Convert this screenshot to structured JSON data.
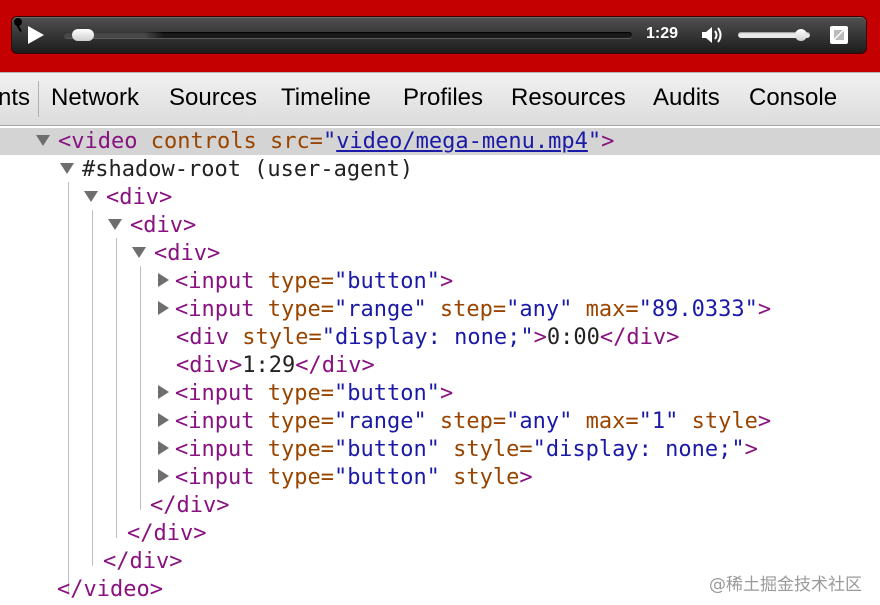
{
  "video_controls": {
    "time": "1:29",
    "playback_progress": 0.015,
    "volume_level": 0.95,
    "icons": [
      "pin-icon",
      "play-icon",
      "volume-icon",
      "fullscreen-icon"
    ]
  },
  "devtools": {
    "tabs": [
      "nts",
      "Network",
      "Sources",
      "Timeline",
      "Profiles",
      "Resources",
      "Audits",
      "Console"
    ]
  },
  "tree": {
    "r0": {
      "open": "<video",
      "a1": " controls",
      "a2": " src=",
      "q1": "\"",
      "link": "video/mega-menu.mp4",
      "q2": "\"",
      "close": ">"
    },
    "r1": {
      "text": "#shadow-root (user-agent)"
    },
    "r2": {
      "tag": "<div>"
    },
    "r3": {
      "tag": "<div>"
    },
    "r4": {
      "tag": "<div>"
    },
    "r5": {
      "open": "<input",
      "a1": " type=",
      "v1": "\"button\"",
      "close": ">"
    },
    "r6": {
      "open": "<input",
      "a1": " type=",
      "v1": "\"range\"",
      "a2": " step=",
      "v2": "\"any\"",
      "a3": " max=",
      "v3": "\"89.0333\"",
      "close": ">"
    },
    "r7": {
      "open": "<div",
      "a1": " style=",
      "v1": "\"display: none;\"",
      "close": ">",
      "text": "0:00",
      "end": "</div>"
    },
    "r8": {
      "open": "<div>",
      "text": "1:29",
      "end": "</div>"
    },
    "r9": {
      "open": "<input",
      "a1": " type=",
      "v1": "\"button\"",
      "close": ">"
    },
    "r10": {
      "open": "<input",
      "a1": " type=",
      "v1": "\"range\"",
      "a2": " step=",
      "v2": "\"any\"",
      "a3": " max=",
      "v3": "\"1\"",
      "a4": " style",
      "close": ">"
    },
    "r11": {
      "open": "<input",
      "a1": " type=",
      "v1": "\"button\"",
      "a2": " style=",
      "v2": "\"display: none;\"",
      "close": ">"
    },
    "r12": {
      "open": "<input",
      "a1": " type=",
      "v1": "\"button\"",
      "a2": " style",
      "close": ">"
    },
    "r13": {
      "tag": "</div>"
    },
    "r14": {
      "tag": "</div>"
    },
    "r15": {
      "tag": "</div>"
    },
    "r16": {
      "tag": "</video>"
    }
  },
  "watermark": "@稀土掘金技术社区",
  "colors": {
    "video_background": "#c50000",
    "tag": "#881280",
    "attribute": "#994500",
    "value": "#1a1aa6",
    "selected_row": "#d4d4d4"
  }
}
